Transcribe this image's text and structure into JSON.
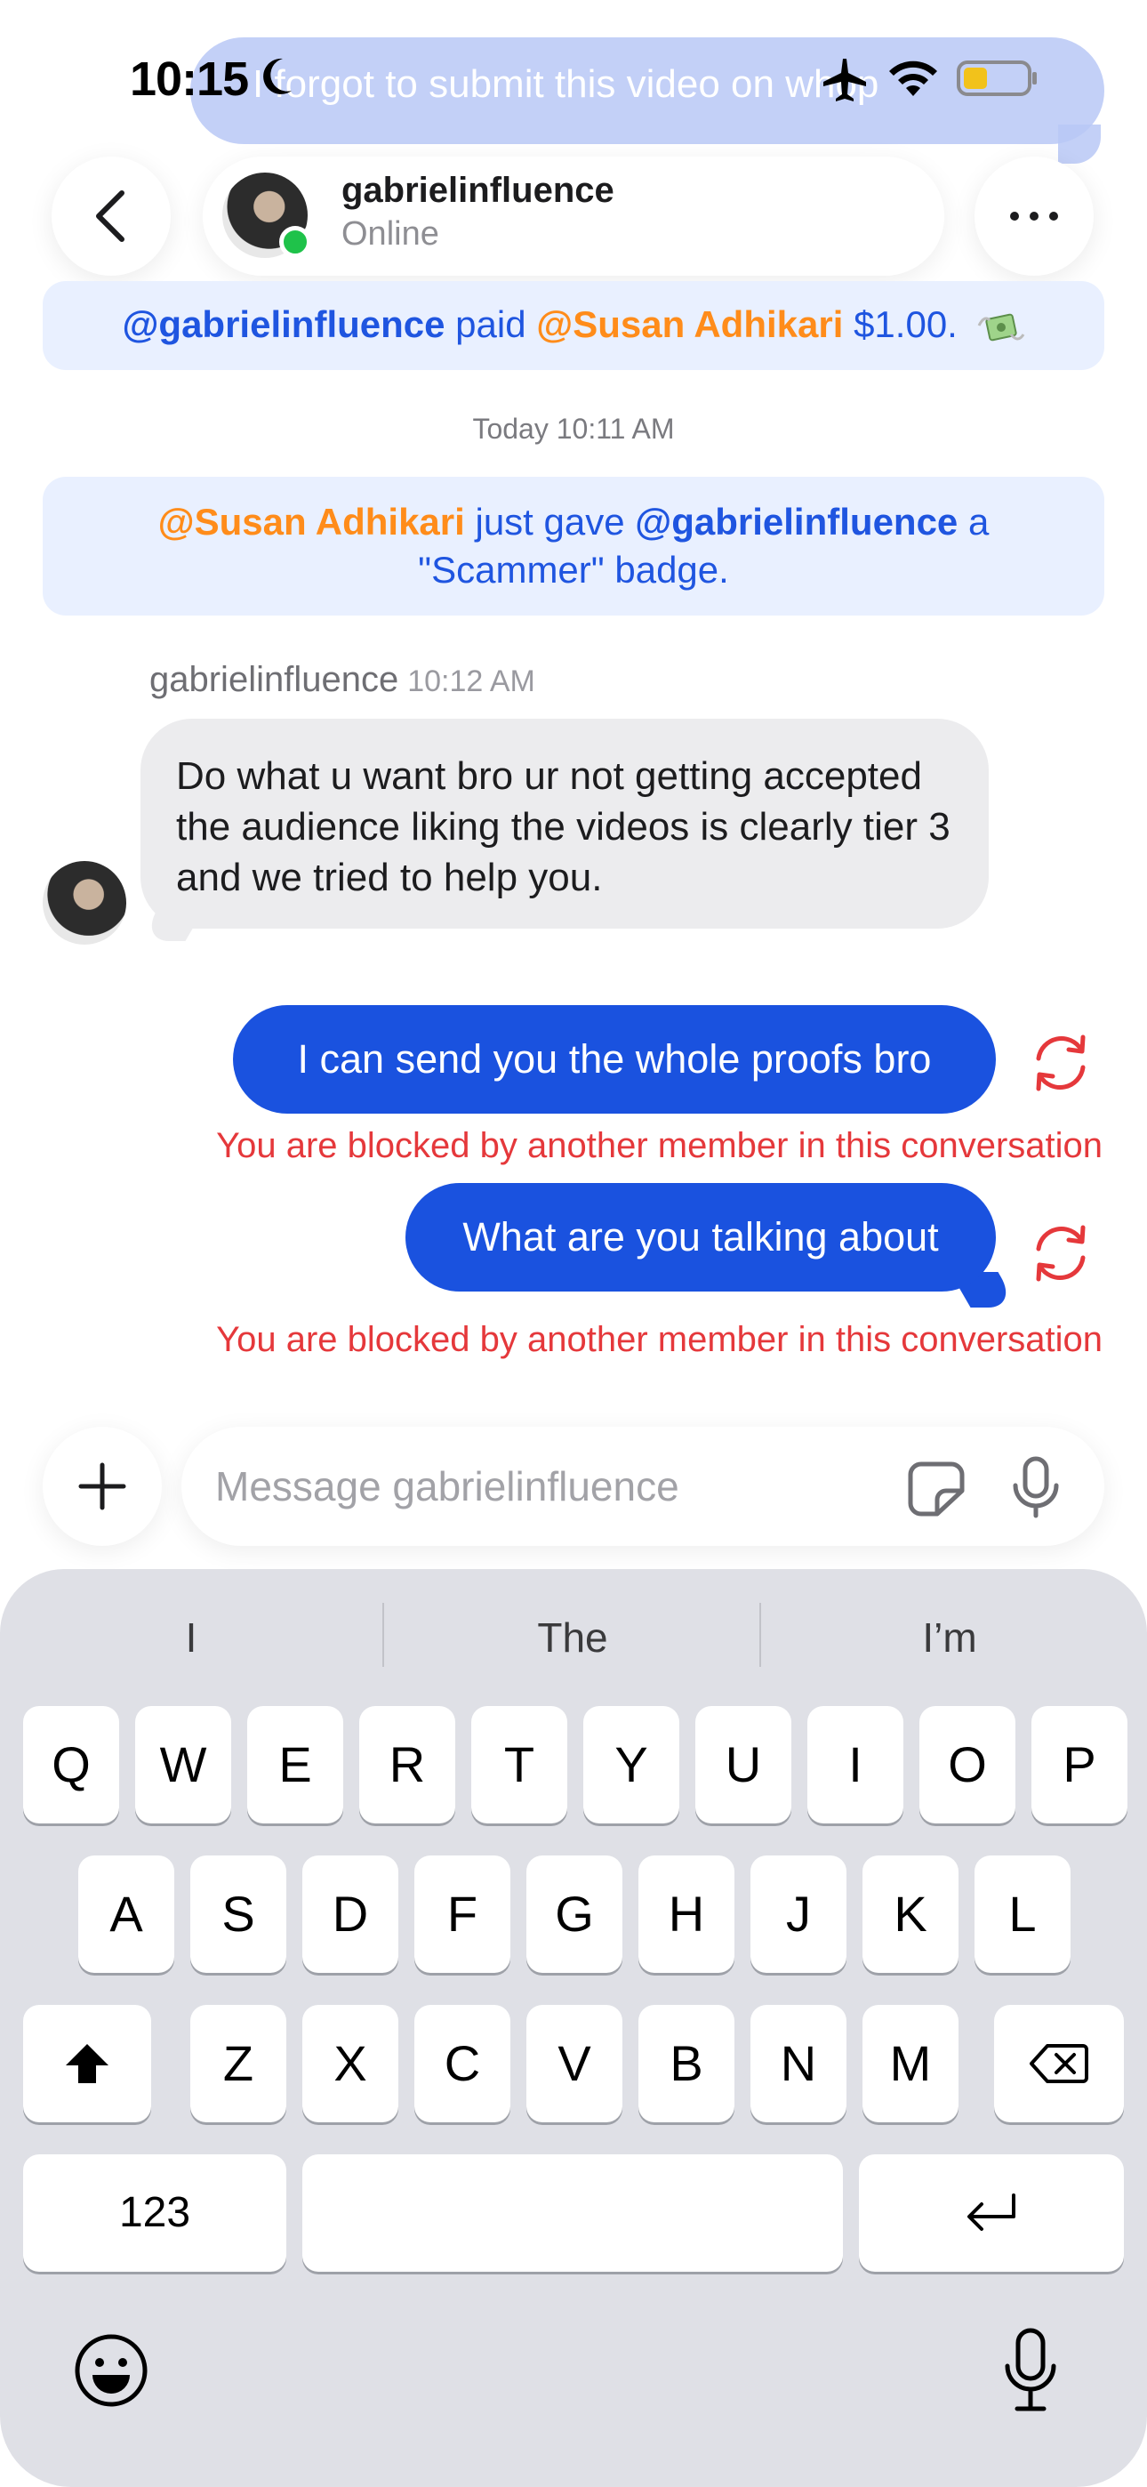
{
  "background_message": {
    "text": "I forgot to submit this video on whop"
  },
  "status_bar": {
    "time": "10:15"
  },
  "header": {
    "contact_name": "gabrielinfluence",
    "contact_status": "Online"
  },
  "chat": {
    "payment_notice": {
      "payer": "@gabrielinfluence",
      "verb": " paid ",
      "payee": "@Susan Adhikari",
      "amount": " $1.00."
    },
    "timestamp": "Today 10:11 AM",
    "badge_notice": {
      "actor": "@Susan Adhikari",
      "verb": " just gave ",
      "target": "@gabrielinfluence",
      "rest": " a \"Scammer\" badge."
    },
    "incoming": {
      "sender": "gabrielinfluence",
      "time": "10:12 AM",
      "text": "Do what u want bro ur not getting accepted the audience liking the videos is clearly tier 3 and we tried to help you."
    },
    "outgoing": [
      {
        "text": "I can send you the whole proofs bro",
        "error": "You are blocked by another member in this conversation"
      },
      {
        "text": "What are you talking about",
        "error": "You are blocked by another member in this conversation"
      }
    ]
  },
  "composer": {
    "placeholder": "Message gabrielinfluence"
  },
  "keyboard": {
    "suggestions": [
      "I",
      "The",
      "I’m"
    ],
    "row1": [
      "Q",
      "W",
      "E",
      "R",
      "T",
      "Y",
      "U",
      "I",
      "O",
      "P"
    ],
    "row2": [
      "A",
      "S",
      "D",
      "F",
      "G",
      "H",
      "J",
      "K",
      "L"
    ],
    "row3": [
      "Z",
      "X",
      "C",
      "V",
      "B",
      "N",
      "M"
    ],
    "numbers_key": "123",
    "space_key": ""
  },
  "colors": {
    "accent_blue": "#1a52df",
    "mention_orange": "#ff8c1a",
    "error_red": "#e5383b",
    "online_green": "#1fc24a"
  }
}
